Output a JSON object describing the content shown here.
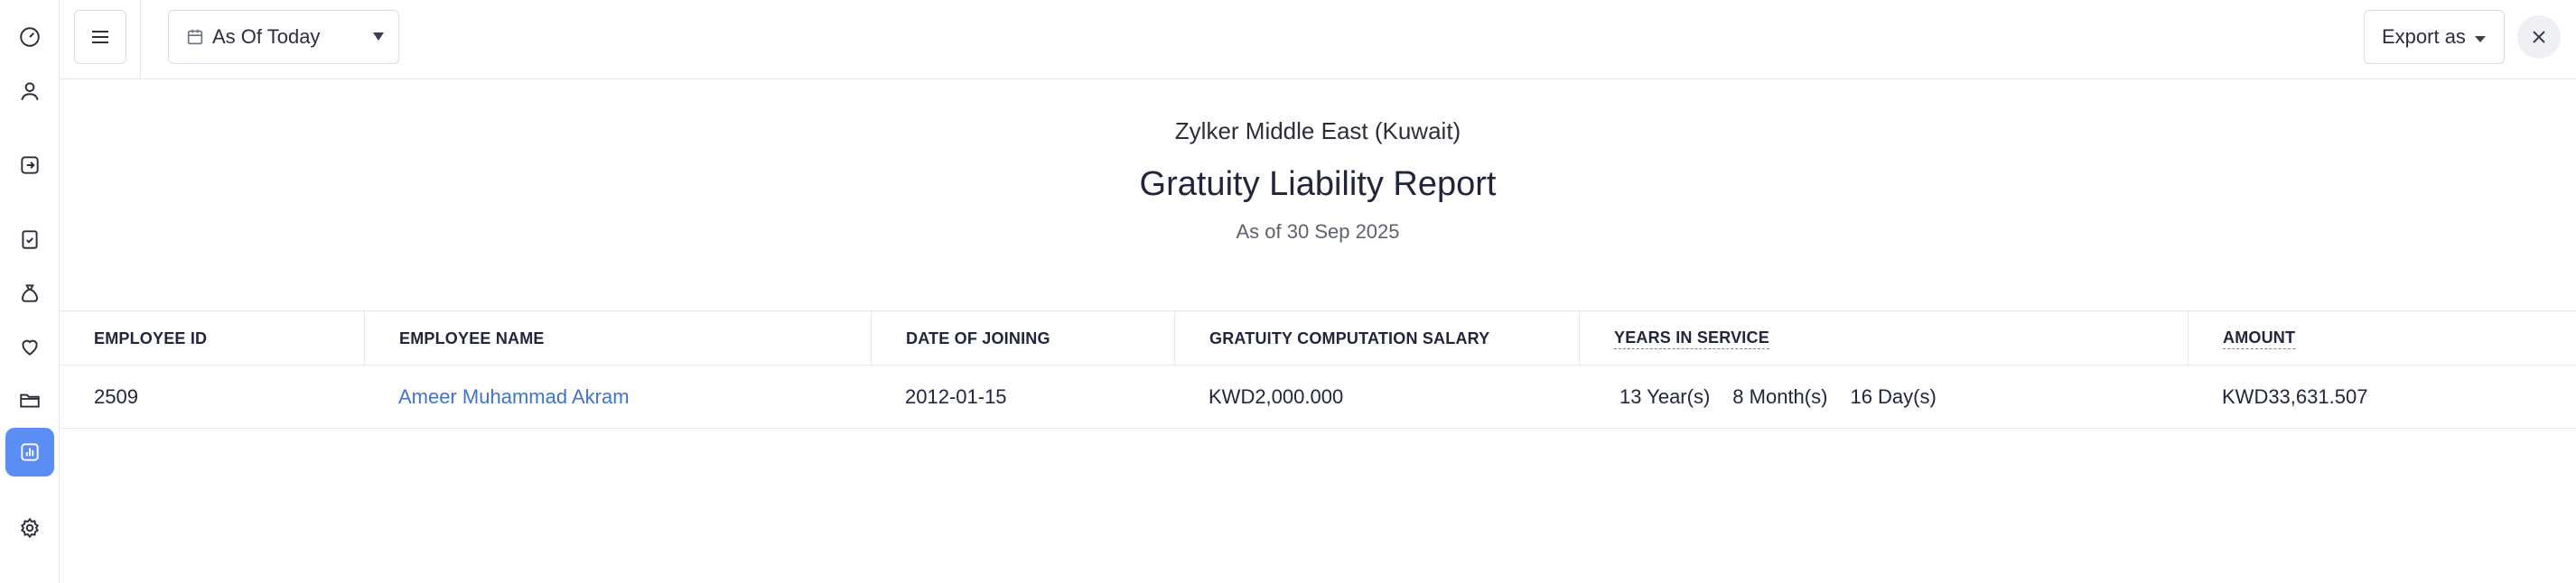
{
  "sidebar": {
    "items": [
      {
        "icon": "dashboard-icon",
        "active": false
      },
      {
        "icon": "user-icon",
        "active": false
      },
      {
        "icon": "login-icon",
        "active": false
      },
      {
        "icon": "checklist-icon",
        "active": false
      },
      {
        "icon": "money-bag-icon",
        "active": false
      },
      {
        "icon": "heart-icon",
        "active": false
      },
      {
        "icon": "folder-icon",
        "active": false
      },
      {
        "icon": "reports-icon",
        "active": true
      },
      {
        "icon": "settings-icon",
        "active": false
      }
    ],
    "accent_color": "#5b8ef5"
  },
  "toolbar": {
    "date_filter": "As Of Today",
    "export_label": "Export as"
  },
  "report": {
    "organization": "Zylker Middle East (Kuwait)",
    "title": "Gratuity Liability Report",
    "as_of": "As of 30 Sep 2025"
  },
  "table": {
    "columns": [
      "EMPLOYEE ID",
      "EMPLOYEE NAME",
      "DATE OF JOINING",
      "GRATUITY COMPUTATION SALARY",
      "YEARS IN SERVICE",
      "AMOUNT"
    ],
    "rows": [
      {
        "employee_id": "2509",
        "employee_name": "Ameer Muhammad Akram",
        "date_of_joining": "2012-01-15",
        "salary": "KWD2,000.000",
        "service_years": "13 Year(s)",
        "service_months": "8 Month(s)",
        "service_days": "16 Day(s)",
        "amount": "KWD33,631.507"
      }
    ],
    "link_color": "#3f74c8"
  }
}
